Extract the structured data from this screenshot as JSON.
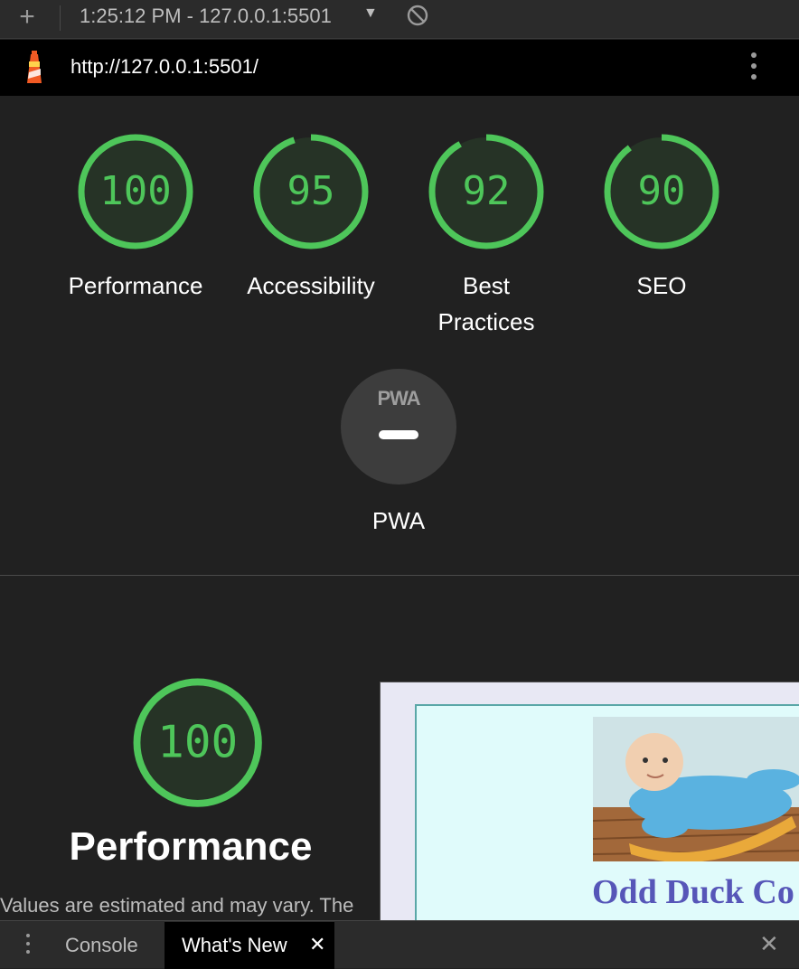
{
  "toolbar": {
    "add_label": "+",
    "report_label": "1:25:12 PM - 127.0.0.1:5501",
    "dropdown_caret": "▼"
  },
  "urlbar": {
    "url": "http://127.0.0.1:5501/"
  },
  "accent_color": "#4ec65a",
  "scores": [
    {
      "value": "100",
      "fraction": 1.0,
      "label_lines": [
        "Performance"
      ]
    },
    {
      "value": "95",
      "fraction": 0.95,
      "label_lines": [
        "Accessibility"
      ]
    },
    {
      "value": "92",
      "fraction": 0.92,
      "label_lines": [
        "Best",
        "Practices"
      ]
    },
    {
      "value": "90",
      "fraction": 0.9,
      "label_lines": [
        "SEO"
      ]
    }
  ],
  "pwa": {
    "badge_text": "PWA",
    "label": "PWA"
  },
  "performance_section": {
    "score": "100",
    "fraction": 1.0,
    "title": "Performance",
    "note": "Values are estimated and may vary. The"
  },
  "preview": {
    "site_title": "Odd Duck Co"
  },
  "drawer": {
    "console_tab": "Console",
    "whats_new_tab": "What's New",
    "close_tab": "✕",
    "close_drawer": "✕"
  }
}
